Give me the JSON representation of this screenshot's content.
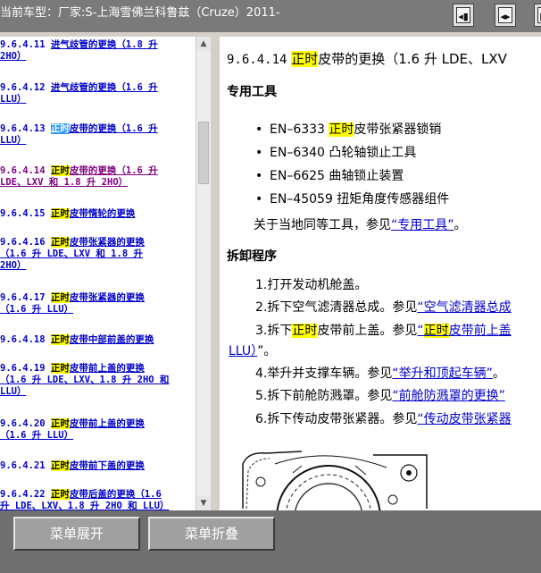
{
  "header": {
    "title": "当前车型：厂家:S-上海雪佛兰科鲁兹（Cruze）2011-",
    "buttons": [
      {
        "icon": "back-page-icon",
        "glyph": "◂▮"
      },
      {
        "icon": "split-view-icon",
        "glyph": "◂▸"
      },
      {
        "icon": "forward-page-icon",
        "glyph": "▮▸"
      }
    ]
  },
  "tree": {
    "items": [
      {
        "num": "9.6.4.11",
        "lines": [
          "进气歧管的更换（1.8 升",
          "2HO）"
        ],
        "highlight": "",
        "state": "normal"
      },
      {
        "num": "9.6.4.12",
        "lines": [
          "进气歧管的更换（1.6 升",
          "LLU）"
        ],
        "highlight": "",
        "state": "normal"
      },
      {
        "num": "9.6.4.13",
        "pre": "",
        "highlight": "正时",
        "lines": [
          "皮带的更换（1.6 升",
          "LLU）"
        ],
        "state": "selected"
      },
      {
        "num": "9.6.4.14",
        "pre": "",
        "highlight": "正时",
        "lines": [
          "皮带的更换（1.6 升",
          "LDE、LXV 和 1.8 升 2HO）"
        ],
        "state": "visited"
      },
      {
        "num": "9.6.4.15",
        "pre": "",
        "highlight": "正时",
        "lines": [
          "皮带惰轮的更换"
        ],
        "state": "normal"
      },
      {
        "num": "9.6.4.16",
        "pre": "",
        "highlight": "正时",
        "lines": [
          "皮带张紧器的更换",
          "（1.6 升 LDE、LXV 和 1.8 升",
          "2HO）"
        ],
        "state": "normal"
      },
      {
        "num": "9.6.4.17",
        "pre": "",
        "highlight": "正时",
        "lines": [
          "皮带张紧器的更换",
          "（1.6 升 LLU）"
        ],
        "state": "normal"
      },
      {
        "num": "9.6.4.18",
        "pre": "",
        "highlight": "正时",
        "lines": [
          "皮带中部前盖的更换"
        ],
        "state": "normal"
      },
      {
        "num": "9.6.4.19",
        "pre": "",
        "highlight": "正时",
        "lines": [
          "皮带前上盖的更换",
          "（1.6 升 LDE、LXV、1.8 升 2HO 和",
          "LLU）"
        ],
        "state": "normal"
      },
      {
        "num": "9.6.4.20",
        "pre": "",
        "highlight": "正时",
        "lines": [
          "皮带前上盖的更换",
          "（1.6 升 LLU）"
        ],
        "state": "normal"
      },
      {
        "num": "9.6.4.21",
        "pre": "",
        "highlight": "正时",
        "lines": [
          "皮带前下盖的更换"
        ],
        "state": "normal"
      },
      {
        "num": "9.6.4.22",
        "pre": "",
        "highlight": "正时",
        "lines": [
          "皮带后盖的更换（1.6",
          "升 LDE、LXV、1.8 升 2HO 和 LLU）"
        ],
        "state": "normal"
      }
    ]
  },
  "content": {
    "heading_num": "9.6.4.14",
    "heading_hl": "正时",
    "heading_rest": "皮带的更换（1.6 升 LDE、LXV",
    "tools_title": "专用工具",
    "tools": [
      {
        "pre": "EN–6333 ",
        "hl": "正时",
        "post": "皮带张紧器锁销"
      },
      {
        "pre": "EN–6340 凸轮轴锁止工具",
        "hl": "",
        "post": ""
      },
      {
        "pre": "EN–6625 曲轴锁止装置",
        "hl": "",
        "post": ""
      },
      {
        "pre": "EN–45059 扭矩角度传感器组件",
        "hl": "",
        "post": ""
      }
    ],
    "tools_ref_pre": "关于当地同等工具，参见",
    "tools_ref_link": "“专用工具”",
    "tools_ref_post": "。",
    "proc_title": "拆卸程序",
    "steps": [
      {
        "pre": "1.打开发动机舱盖。",
        "hl": "",
        "mid": "",
        "link": "",
        "linkhl": "",
        "linkpost": ""
      },
      {
        "pre": "2.拆下空气滤清器总成。参见",
        "hl": "",
        "mid": "",
        "link": "“空气滤清器总成",
        "linkhl": "",
        "linkpost": ""
      },
      {
        "pre": "3.拆下",
        "hl": "正时",
        "mid": "皮带前上盖。参见",
        "link": "“",
        "linkhl": "正时",
        "linkpost": "皮带前上盖"
      },
      {
        "pre": "4.举升并支撑车辆。参见",
        "hl": "",
        "mid": "",
        "link": "“举升和顶起车辆”",
        "linkhl": "",
        "linkpost": "。"
      },
      {
        "pre": "5.拆下前舱防溅罩。参见",
        "hl": "",
        "mid": "",
        "link": "“前舱防溅罩的更换”",
        "linkhl": "",
        "linkpost": ""
      },
      {
        "pre": "6.拆下传动皮带张紧器。参见",
        "hl": "",
        "mid": "",
        "link": "“传动皮带张紧器",
        "linkhl": "",
        "linkpost": ""
      }
    ],
    "step3_cont_link": "LLU）",
    "step3_cont_post": "”。"
  },
  "footer": {
    "expand_label": "菜单展开",
    "collapse_label": "菜单折叠"
  }
}
